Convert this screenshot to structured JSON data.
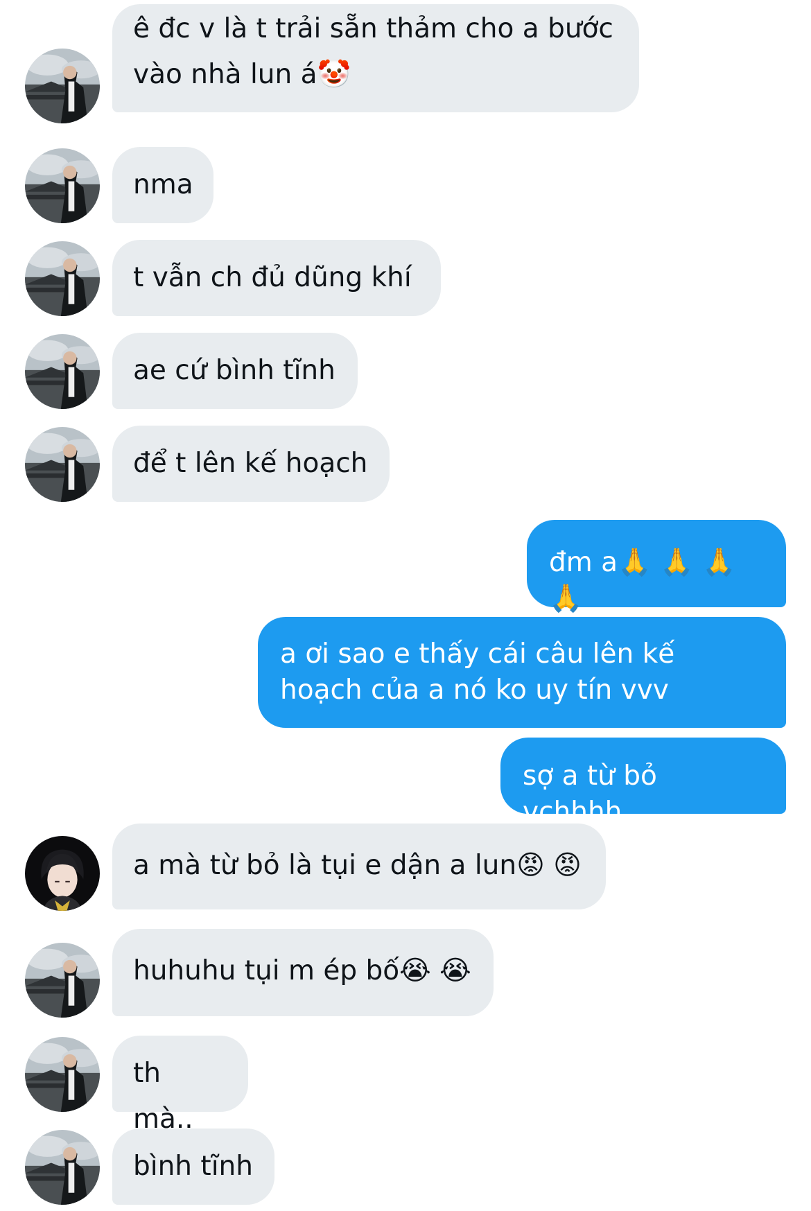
{
  "conversation": {
    "messages": [
      {
        "sender": "other",
        "avatar": "avatar-landscape",
        "text": "ê đc v là t trải sẵn thảm cho a bước vào nhà lun á🤡"
      },
      {
        "sender": "other",
        "avatar": "avatar-landscape",
        "text": "nma"
      },
      {
        "sender": "other",
        "avatar": "avatar-landscape",
        "text": "t vẫn ch đủ dũng khí"
      },
      {
        "sender": "other",
        "avatar": "avatar-landscape",
        "text": "ae cứ bình tĩnh"
      },
      {
        "sender": "other",
        "avatar": "avatar-landscape",
        "text": "để t lên kế hoạch"
      },
      {
        "sender": "me",
        "text": "đm a🙏 🙏 🙏 🙏"
      },
      {
        "sender": "me",
        "text": "a ơi sao e thấy cái câu lên kế hoạch của a nó ko uy tín vvv"
      },
      {
        "sender": "me",
        "text": "sợ a từ bỏ vchhhh"
      },
      {
        "sender": "other",
        "avatar": "avatar-dark-portrait",
        "text": "a mà từ bỏ là tụi e dận a lun😡 😡"
      },
      {
        "sender": "other",
        "avatar": "avatar-landscape",
        "text": "huhuhu tụi m ép bố😭 😭"
      },
      {
        "sender": "other",
        "avatar": "avatar-landscape",
        "text": "th mà.."
      },
      {
        "sender": "other",
        "avatar": "avatar-landscape",
        "text": "bình tĩnh"
      }
    ]
  },
  "colors": {
    "incoming_bubble": "#e8ecef",
    "outgoing_bubble": "#1d9bf0",
    "incoming_text": "#0f1419",
    "outgoing_text": "#ffffff"
  }
}
